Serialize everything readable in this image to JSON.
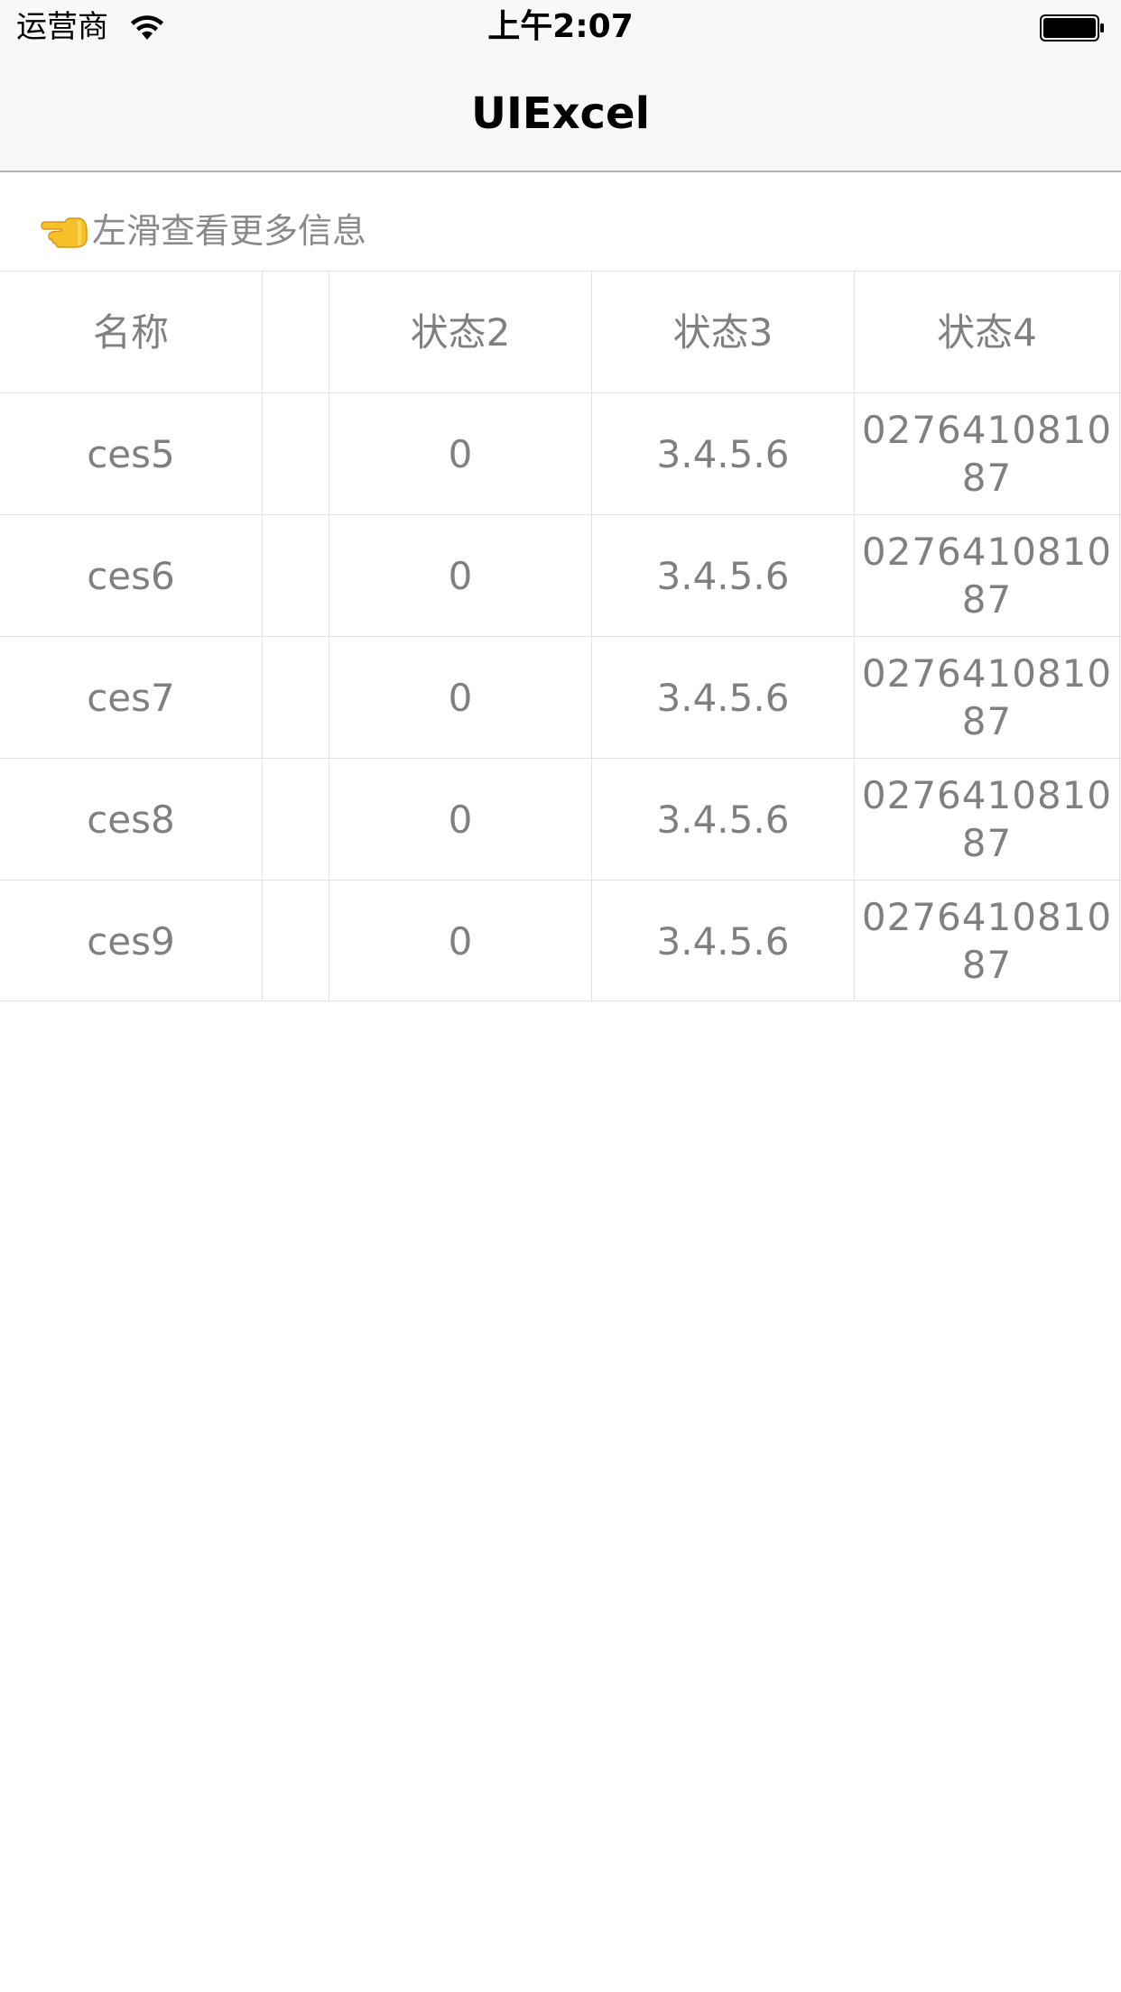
{
  "status_bar": {
    "carrier": "运营商",
    "time": "上午2:07"
  },
  "nav": {
    "title": "UIExcel"
  },
  "hint": {
    "icon": "pointing-left-hand-icon",
    "text": "左滑查看更多信息"
  },
  "table": {
    "headers": [
      "名称",
      "",
      "状态2",
      "状态3",
      "状态4"
    ],
    "rows": [
      [
        "ces5",
        "",
        "0",
        "3.4.5.6",
        "027641081087"
      ],
      [
        "ces6",
        "",
        "0",
        "3.4.5.6",
        "027641081087"
      ],
      [
        "ces7",
        "",
        "0",
        "3.4.5.6",
        "027641081087"
      ],
      [
        "ces8",
        "",
        "0",
        "3.4.5.6",
        "027641081087"
      ],
      [
        "ces9",
        "",
        "0",
        "3.4.5.6",
        "027641081087"
      ]
    ]
  },
  "colors": {
    "bar_background": "#f8f8f8",
    "cell_text": "#808080",
    "grid_line": "#e2e2e2",
    "hint_text": "#8a8a8a"
  }
}
